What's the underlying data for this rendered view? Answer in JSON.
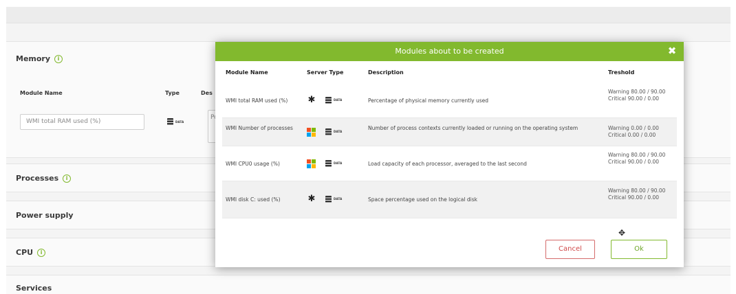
{
  "background": {
    "sections": {
      "memory": "Memory",
      "processes": "Processes",
      "power_supply": "Power supply",
      "cpu": "CPU",
      "services": "Services"
    },
    "columns": {
      "module_name": "Module Name",
      "type": "Type",
      "description_partial": "Des"
    },
    "module_input_value": "WMI total RAM used (%)",
    "description_partial_value": "Po",
    "data_badge": "DATA"
  },
  "modal": {
    "title": "Modules about to be created",
    "close_icon": "close-icon",
    "columns": {
      "module_name": "Module Name",
      "server_type": "Server Type",
      "description": "Description",
      "threshold": "Treshold"
    },
    "rows": [
      {
        "name": "WMI total RAM used (%)",
        "os_icon": "generic-os-icon",
        "data_badge": "DATA",
        "description": "Percentage of physical memory currently used",
        "threshold_warning": "Warning 80.00 / 90.00",
        "threshold_critical": "Critical 90.00 / 0.00"
      },
      {
        "name": "WMI Number of processes",
        "os_icon": "windows-icon",
        "data_badge": "DATA",
        "description": "Number of process contexts currently loaded or running on the operating system",
        "threshold_warning": "Warning 0.00 / 0.00",
        "threshold_critical": "Critical 0.00 / 0.00"
      },
      {
        "name": "WMI CPU0 usage (%)",
        "os_icon": "windows-icon",
        "data_badge": "DATA",
        "description": "Load capacity of each processor, averaged to the last second",
        "threshold_warning": "Warning 80.00 / 90.00",
        "threshold_critical": "Critical 90.00 / 0.00"
      },
      {
        "name": "WMI disk C: used (%)",
        "os_icon": "generic-os-icon",
        "data_badge": "DATA",
        "description": "Space percentage used on the logical disk",
        "threshold_warning": "Warning 80.00 / 90.00",
        "threshold_critical": "Critical 90.00 / 0.00"
      }
    ],
    "cancel_label": "Cancel",
    "ok_label": "Ok"
  },
  "colors": {
    "accent_green": "#82b92e",
    "cancel_red": "#d04848",
    "windows_red": "#f25022",
    "windows_green": "#7fba00",
    "windows_blue": "#00a4ef",
    "windows_yellow": "#ffb900"
  }
}
